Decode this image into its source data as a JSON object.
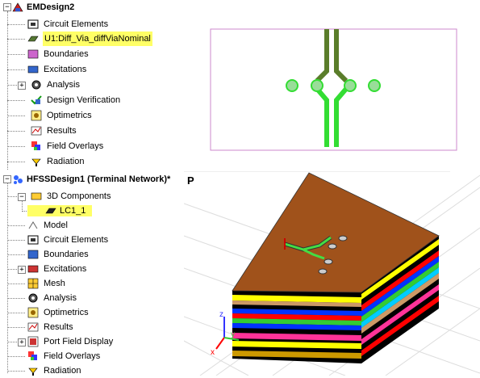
{
  "top_tree": {
    "root_label": "EMDesign2",
    "items": [
      {
        "label": "Circuit Elements"
      },
      {
        "label": "U1:Diff_Via_diffViaNominal"
      },
      {
        "label": "Boundaries"
      },
      {
        "label": "Excitations"
      },
      {
        "label": "Analysis"
      },
      {
        "label": "Design Verification"
      },
      {
        "label": "Optimetrics"
      },
      {
        "label": "Results"
      },
      {
        "label": "Field Overlays"
      },
      {
        "label": "Radiation"
      }
    ]
  },
  "bottom_tree": {
    "root_label": "HFSSDesign1 (Terminal Network)*",
    "items": [
      {
        "label": "3D Components"
      },
      {
        "label": "LC1_1"
      },
      {
        "label": "Model"
      },
      {
        "label": "Circuit Elements"
      },
      {
        "label": "Boundaries"
      },
      {
        "label": "Excitations"
      },
      {
        "label": "Mesh"
      },
      {
        "label": "Analysis"
      },
      {
        "label": "Optimetrics"
      },
      {
        "label": "Results"
      },
      {
        "label": "Port Field Display"
      },
      {
        "label": "Field Overlays"
      },
      {
        "label": "Radiation"
      }
    ]
  },
  "cut_label": "P",
  "axes": {
    "x": "x",
    "y": "y",
    "z": "z"
  },
  "colors": {
    "highlight": "#ffff66",
    "trace_dark": "#5a7d2a",
    "trace_bright": "#33dd33",
    "pad": "#99dd99",
    "board_top": "#a0521b",
    "layer_colors": [
      "#ffff00",
      "#000000",
      "#ff0000",
      "#0033ff",
      "#33cc33",
      "#00ccff",
      "#ff3399",
      "#cc9900"
    ]
  }
}
